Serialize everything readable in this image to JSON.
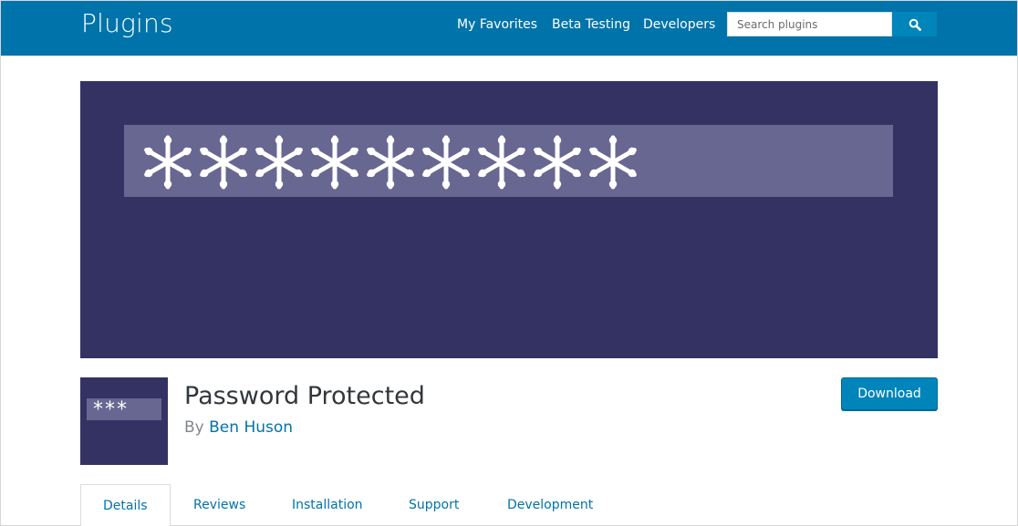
{
  "header": {
    "site_title": "Plugins",
    "nav": [
      {
        "label": "My Favorites"
      },
      {
        "label": "Beta Testing"
      },
      {
        "label": "Developers"
      }
    ],
    "search": {
      "placeholder": "Search plugins",
      "value": "",
      "button_icon": "search-icon"
    }
  },
  "banner": {
    "field_text": "*********"
  },
  "plugin": {
    "icon_text": "***",
    "name": "Password Protected",
    "by_label": "By",
    "author": "Ben Huson",
    "download_label": "Download"
  },
  "tabs": [
    {
      "label": "Details",
      "active": true
    },
    {
      "label": "Reviews",
      "active": false
    },
    {
      "label": "Installation",
      "active": false
    },
    {
      "label": "Support",
      "active": false
    },
    {
      "label": "Development",
      "active": false
    }
  ],
  "colors": {
    "header_bg": "#0073aa",
    "banner_bg": "#343263",
    "banner_field": "#686791",
    "link": "#0073aa",
    "button": "#0085ba"
  }
}
